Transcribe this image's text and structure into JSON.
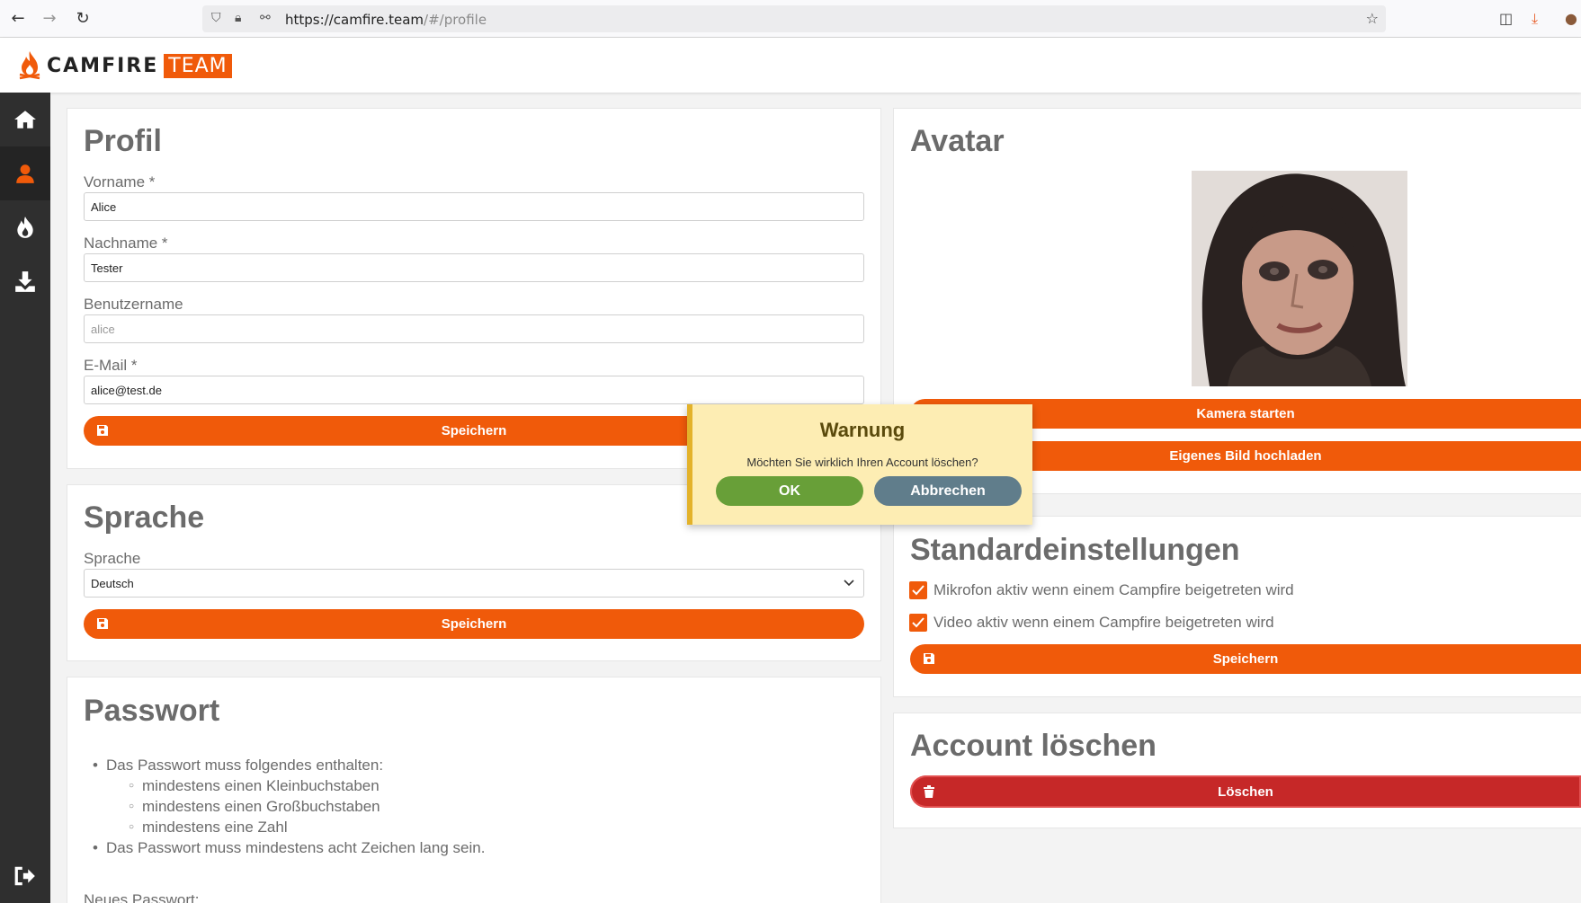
{
  "browser": {
    "url_host": "https://camfire.team",
    "url_path": "/#/profile"
  },
  "logo": {
    "word": "CAMFIRE",
    "team": "TEAM",
    "brand_color": "#f05a0a"
  },
  "sidebar": {
    "items": [
      {
        "icon": "home-icon"
      },
      {
        "icon": "user-icon"
      },
      {
        "icon": "fire-icon"
      },
      {
        "icon": "download-icon"
      },
      {
        "icon": "logout-icon"
      }
    ]
  },
  "profile": {
    "title": "Profil",
    "firstname_label": "Vorname *",
    "firstname_value": "Alice",
    "lastname_label": "Nachname *",
    "lastname_value": "Tester",
    "username_label": "Benutzername",
    "username_value": "alice",
    "email_label": "E-Mail *",
    "email_value": "alice@test.de",
    "save_label": "Speichern"
  },
  "language": {
    "title": "Sprache",
    "label": "Sprache",
    "selected": "Deutsch",
    "save_label": "Speichern"
  },
  "password": {
    "title": "Passwort",
    "rule_intro": "Das Passwort muss folgendes enthalten:",
    "rules": [
      "mindestens einen Kleinbuchstaben",
      "mindestens einen Großbuchstaben",
      "mindestens eine Zahl"
    ],
    "rule_length": "Das Passwort muss mindestens acht Zeichen lang sein.",
    "new_password_label": "Neues Passwort:"
  },
  "avatar": {
    "title": "Avatar",
    "camera_label": "Kamera starten",
    "upload_label": "Eigenes Bild hochladen"
  },
  "defaults": {
    "title": "Standardeinstellungen",
    "mic_label": "Mikrofon aktiv wenn einem Campfire beigetreten wird",
    "video_label": "Video aktiv wenn einem Campfire beigetreten wird",
    "mic_checked": true,
    "video_checked": true,
    "save_label": "Speichern"
  },
  "delete_account": {
    "title": "Account löschen",
    "delete_label": "Löschen"
  },
  "dialog": {
    "title": "Warnung",
    "message": "Möchten Sie wirklich Ihren Account löschen?",
    "ok_label": "OK",
    "cancel_label": "Abbrechen"
  }
}
